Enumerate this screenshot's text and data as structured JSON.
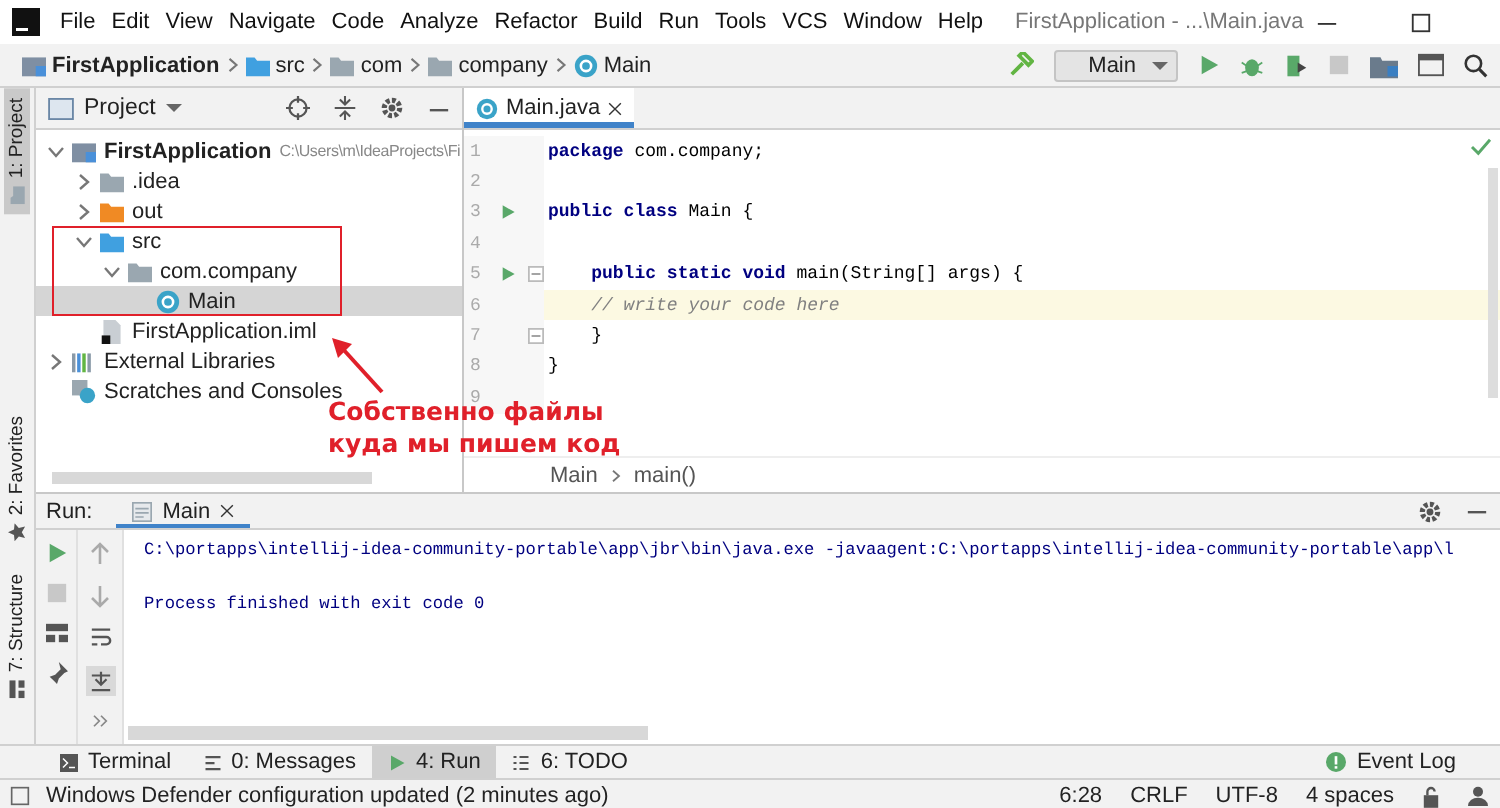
{
  "menu": {
    "items": [
      "File",
      "Edit",
      "View",
      "Navigate",
      "Code",
      "Analyze",
      "Refactor",
      "Build",
      "Run",
      "Tools",
      "VCS",
      "Window",
      "Help"
    ],
    "title": "FirstApplication - ...\\Main.java"
  },
  "navbar": {
    "breadcrumbs": [
      {
        "label": "FirstApplication",
        "kind": "project"
      },
      {
        "label": "src",
        "kind": "source"
      },
      {
        "label": "com",
        "kind": "folder"
      },
      {
        "label": "company",
        "kind": "folder"
      },
      {
        "label": "Main",
        "kind": "class"
      }
    ],
    "run_config": "Main"
  },
  "side_tabs": [
    {
      "label": "1: Project",
      "selected": true,
      "kind": "top"
    },
    {
      "label": "2: Favorites",
      "selected": false,
      "kind": "star"
    },
    {
      "label": "7: Structure",
      "selected": false,
      "kind": "structure"
    }
  ],
  "project": {
    "title": "Project",
    "tree": [
      {
        "label": "FirstApplication",
        "path": "C:\\Users\\m\\IdeaProjects\\Fi",
        "kind": "project",
        "expanded": true,
        "selected": false,
        "children": [
          {
            "label": ".idea",
            "kind": "folder",
            "expanded": false,
            "selected": false
          },
          {
            "label": "out",
            "kind": "excluded",
            "expanded": false,
            "selected": false
          },
          {
            "label": "src",
            "kind": "source",
            "expanded": true,
            "selected": false,
            "children": [
              {
                "label": "com.company",
                "kind": "package",
                "expanded": true,
                "selected": false,
                "children": [
                  {
                    "label": "Main",
                    "kind": "class",
                    "selected": true
                  }
                ]
              }
            ]
          },
          {
            "label": "FirstApplication.iml",
            "kind": "module",
            "selected": false
          }
        ]
      },
      {
        "label": "External Libraries",
        "kind": "library",
        "expanded": false,
        "selected": false
      },
      {
        "label": "Scratches and Consoles",
        "kind": "scratches",
        "selected": false
      }
    ]
  },
  "annotation": {
    "text": "Собственно файлы\nкуда мы пишем код"
  },
  "editor": {
    "tabs": [
      {
        "label": "Main.java",
        "selected": true
      }
    ],
    "lines": [
      {
        "number": "1",
        "code": "**package** com.company;",
        "run_marker": false,
        "fold_marker": false,
        "current": false
      },
      {
        "number": "2",
        "run_marker": false,
        "fold_marker": false,
        "current": false
      },
      {
        "number": "3",
        "code": "**public class** Main {",
        "run_marker": true,
        "fold_marker": false,
        "current": false
      },
      {
        "number": "4",
        "run_marker": false,
        "fold_marker": false,
        "current": false
      },
      {
        "number": "5",
        "code": "    **public static void** main(String[] args) {",
        "run_marker": true,
        "fold_marker": true,
        "current": false
      },
      {
        "number": "6",
        "code": "    // write your code here",
        "kind": "comment",
        "run_marker": false,
        "fold_marker": false,
        "current": true
      },
      {
        "number": "7",
        "code": "    }",
        "run_marker": false,
        "fold_marker": true,
        "current": false
      },
      {
        "number": "8",
        "code": "}",
        "run_marker": false,
        "fold_marker": false,
        "current": false
      },
      {
        "number": "9",
        "run_marker": false,
        "fold_marker": false,
        "current": false
      }
    ],
    "breadcrumbs": [
      "Main",
      "main()"
    ]
  },
  "run": {
    "label": "Run:",
    "tabs": [
      {
        "label": "Main",
        "selected": true
      }
    ],
    "output": [
      {
        "text": "C:\\portapps\\intellij-idea-community-portable\\app\\jbr\\bin\\java.exe -javaagent:C:\\portapps\\intellij-idea-community-portable\\app\\l",
        "kind": "command"
      },
      {
        "text": "Process finished with exit code 0",
        "kind": "info"
      }
    ]
  },
  "tool_tabs": [
    {
      "label": "Terminal",
      "kind": "terminal",
      "selected": false
    },
    {
      "label": "0: Messages",
      "kind": "messages",
      "selected": false
    },
    {
      "label": "4: Run",
      "kind": "run",
      "selected": true
    },
    {
      "label": "6: TODO",
      "kind": "todo",
      "selected": false
    }
  ],
  "event_log": "Event Log",
  "status": {
    "message": "Windows Defender configuration updated (2 minutes ago)",
    "items": [
      "6:28",
      "CRLF",
      "UTF-8",
      "4 spaces"
    ]
  }
}
